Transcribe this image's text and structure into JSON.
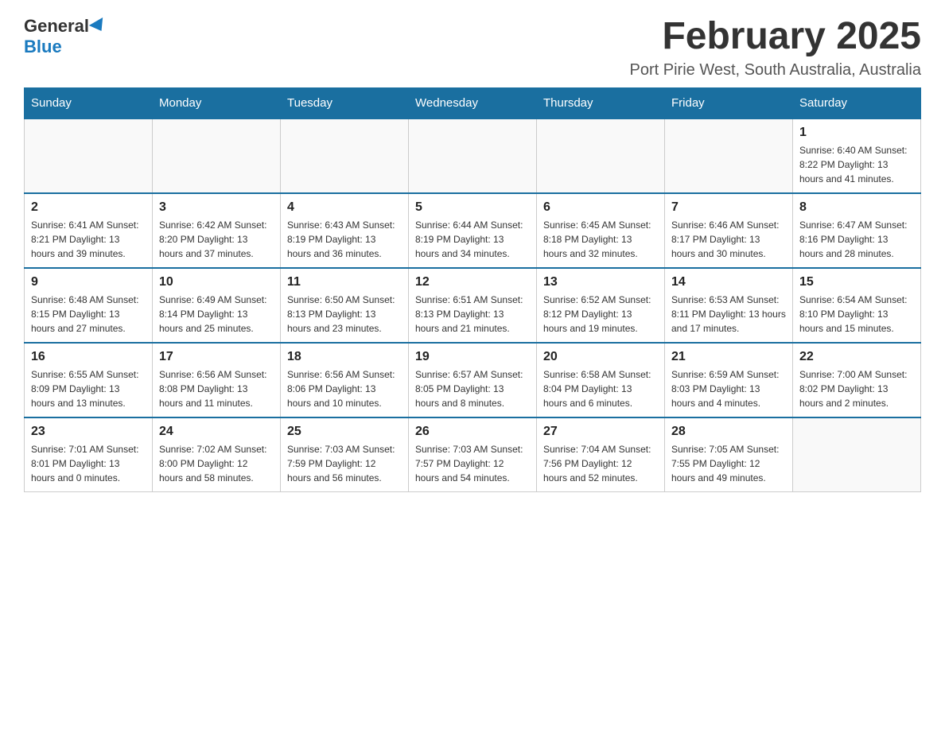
{
  "logo": {
    "general": "General",
    "blue": "Blue"
  },
  "header": {
    "month": "February 2025",
    "location": "Port Pirie West, South Australia, Australia"
  },
  "weekdays": [
    "Sunday",
    "Monday",
    "Tuesday",
    "Wednesday",
    "Thursday",
    "Friday",
    "Saturday"
  ],
  "weeks": [
    [
      {
        "day": "",
        "info": ""
      },
      {
        "day": "",
        "info": ""
      },
      {
        "day": "",
        "info": ""
      },
      {
        "day": "",
        "info": ""
      },
      {
        "day": "",
        "info": ""
      },
      {
        "day": "",
        "info": ""
      },
      {
        "day": "1",
        "info": "Sunrise: 6:40 AM\nSunset: 8:22 PM\nDaylight: 13 hours and 41 minutes."
      }
    ],
    [
      {
        "day": "2",
        "info": "Sunrise: 6:41 AM\nSunset: 8:21 PM\nDaylight: 13 hours and 39 minutes."
      },
      {
        "day": "3",
        "info": "Sunrise: 6:42 AM\nSunset: 8:20 PM\nDaylight: 13 hours and 37 minutes."
      },
      {
        "day": "4",
        "info": "Sunrise: 6:43 AM\nSunset: 8:19 PM\nDaylight: 13 hours and 36 minutes."
      },
      {
        "day": "5",
        "info": "Sunrise: 6:44 AM\nSunset: 8:19 PM\nDaylight: 13 hours and 34 minutes."
      },
      {
        "day": "6",
        "info": "Sunrise: 6:45 AM\nSunset: 8:18 PM\nDaylight: 13 hours and 32 minutes."
      },
      {
        "day": "7",
        "info": "Sunrise: 6:46 AM\nSunset: 8:17 PM\nDaylight: 13 hours and 30 minutes."
      },
      {
        "day": "8",
        "info": "Sunrise: 6:47 AM\nSunset: 8:16 PM\nDaylight: 13 hours and 28 minutes."
      }
    ],
    [
      {
        "day": "9",
        "info": "Sunrise: 6:48 AM\nSunset: 8:15 PM\nDaylight: 13 hours and 27 minutes."
      },
      {
        "day": "10",
        "info": "Sunrise: 6:49 AM\nSunset: 8:14 PM\nDaylight: 13 hours and 25 minutes."
      },
      {
        "day": "11",
        "info": "Sunrise: 6:50 AM\nSunset: 8:13 PM\nDaylight: 13 hours and 23 minutes."
      },
      {
        "day": "12",
        "info": "Sunrise: 6:51 AM\nSunset: 8:13 PM\nDaylight: 13 hours and 21 minutes."
      },
      {
        "day": "13",
        "info": "Sunrise: 6:52 AM\nSunset: 8:12 PM\nDaylight: 13 hours and 19 minutes."
      },
      {
        "day": "14",
        "info": "Sunrise: 6:53 AM\nSunset: 8:11 PM\nDaylight: 13 hours and 17 minutes."
      },
      {
        "day": "15",
        "info": "Sunrise: 6:54 AM\nSunset: 8:10 PM\nDaylight: 13 hours and 15 minutes."
      }
    ],
    [
      {
        "day": "16",
        "info": "Sunrise: 6:55 AM\nSunset: 8:09 PM\nDaylight: 13 hours and 13 minutes."
      },
      {
        "day": "17",
        "info": "Sunrise: 6:56 AM\nSunset: 8:08 PM\nDaylight: 13 hours and 11 minutes."
      },
      {
        "day": "18",
        "info": "Sunrise: 6:56 AM\nSunset: 8:06 PM\nDaylight: 13 hours and 10 minutes."
      },
      {
        "day": "19",
        "info": "Sunrise: 6:57 AM\nSunset: 8:05 PM\nDaylight: 13 hours and 8 minutes."
      },
      {
        "day": "20",
        "info": "Sunrise: 6:58 AM\nSunset: 8:04 PM\nDaylight: 13 hours and 6 minutes."
      },
      {
        "day": "21",
        "info": "Sunrise: 6:59 AM\nSunset: 8:03 PM\nDaylight: 13 hours and 4 minutes."
      },
      {
        "day": "22",
        "info": "Sunrise: 7:00 AM\nSunset: 8:02 PM\nDaylight: 13 hours and 2 minutes."
      }
    ],
    [
      {
        "day": "23",
        "info": "Sunrise: 7:01 AM\nSunset: 8:01 PM\nDaylight: 13 hours and 0 minutes."
      },
      {
        "day": "24",
        "info": "Sunrise: 7:02 AM\nSunset: 8:00 PM\nDaylight: 12 hours and 58 minutes."
      },
      {
        "day": "25",
        "info": "Sunrise: 7:03 AM\nSunset: 7:59 PM\nDaylight: 12 hours and 56 minutes."
      },
      {
        "day": "26",
        "info": "Sunrise: 7:03 AM\nSunset: 7:57 PM\nDaylight: 12 hours and 54 minutes."
      },
      {
        "day": "27",
        "info": "Sunrise: 7:04 AM\nSunset: 7:56 PM\nDaylight: 12 hours and 52 minutes."
      },
      {
        "day": "28",
        "info": "Sunrise: 7:05 AM\nSunset: 7:55 PM\nDaylight: 12 hours and 49 minutes."
      },
      {
        "day": "",
        "info": ""
      }
    ]
  ]
}
